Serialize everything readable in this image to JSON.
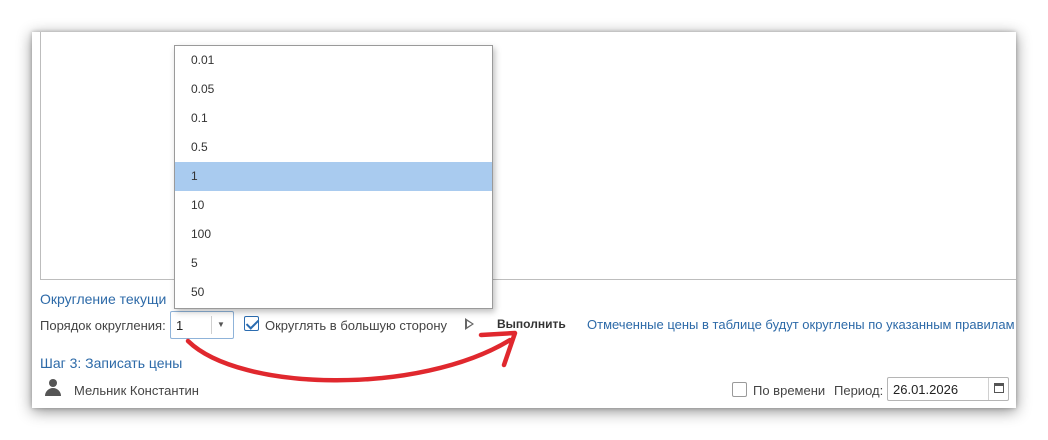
{
  "rounding_section": {
    "title": "Округление текущи",
    "order_label": "Порядок округления:",
    "order_value": "1",
    "round_up_label": "Округлять в большую сторону",
    "round_up_checked": true,
    "run_label": "Выполнить",
    "info_text": "Отмеченные цены в таблице будут округлены по указанным правилам"
  },
  "dropdown": {
    "options": [
      "0.01",
      "0.05",
      "0.1",
      "0.5",
      "1",
      "10",
      "100",
      "5",
      "50"
    ],
    "selected": "1"
  },
  "step3": {
    "title": "Шаг 3: Записать цены"
  },
  "footer": {
    "user_name": "Мельник Константин",
    "by_time_label": "По времени",
    "by_time_checked": false,
    "period_label": "Период:",
    "period_value": "26.01.2026"
  },
  "colors": {
    "link": "#2d6aa8",
    "selection": "#a9cbef",
    "annotation_arrow": "#e0282e"
  },
  "icons": [
    "chevron-down-icon",
    "play-icon",
    "user-icon",
    "calendar-icon"
  ]
}
